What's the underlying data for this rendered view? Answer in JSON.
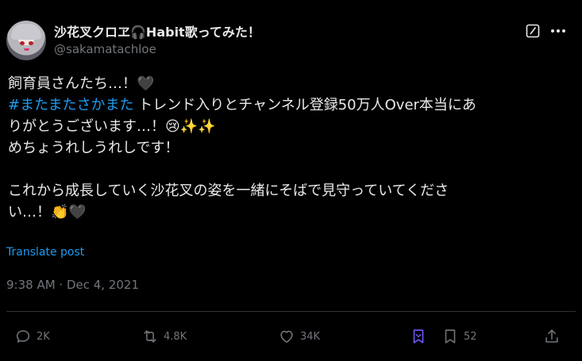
{
  "author": {
    "display_name": "沙花叉クロヱ🎧Habit歌ってみた！",
    "handle": "@sakamatachloe"
  },
  "tweet": {
    "line1": "飼育員さんたち…！🖤",
    "hashtag": "#またまたさかまた",
    "line2_rest": " トレンド入りとチャンネル登録50万人Over本当にあ",
    "line3": "りがとうございます…！😢✨✨",
    "line4": "めちょうれしうれしです！",
    "line5": "これから成長していく沙花叉の姿を一緒にそばで見守っていてくださ",
    "line6": "い…！👏🖤"
  },
  "translate_label": "Translate post",
  "timestamp": "9:38 AM · Dec 4, 2021",
  "actions": {
    "replies": "2K",
    "reposts": "4.8K",
    "likes": "34K",
    "bookmarks": "52"
  },
  "colors": {
    "background": "#000000",
    "text": "#e7e9ea",
    "muted": "#71767b",
    "link": "#1d9bf0",
    "grok_accent": "#7856ff"
  }
}
